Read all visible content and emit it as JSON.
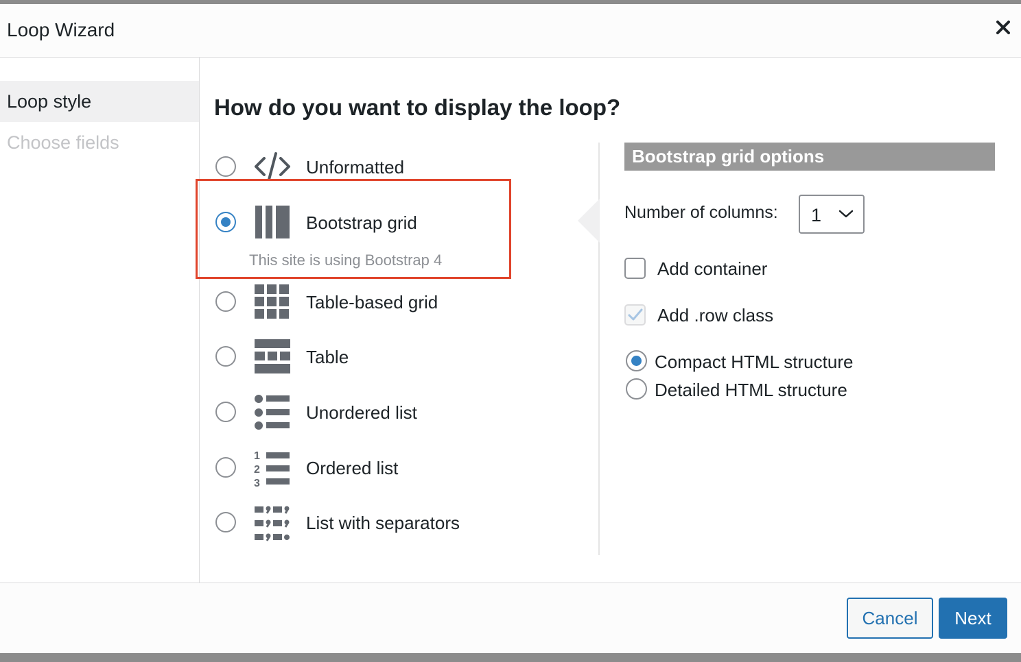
{
  "dialog": {
    "title": "Loop Wizard"
  },
  "sidebar": {
    "items": [
      {
        "label": "Loop style"
      },
      {
        "label": "Choose fields"
      }
    ]
  },
  "main": {
    "question": "How do you want to display the loop?",
    "options": [
      {
        "label": "Unformatted",
        "icon": "code-icon",
        "selected": false
      },
      {
        "label": "Bootstrap grid",
        "icon": "bootstrap-grid-icon",
        "selected": true,
        "note": "This site is using Bootstrap 4"
      },
      {
        "label": "Table-based grid",
        "icon": "table-grid-icon",
        "selected": false
      },
      {
        "label": "Table",
        "icon": "table-icon",
        "selected": false
      },
      {
        "label": "Unordered list",
        "icon": "unordered-list-icon",
        "selected": false
      },
      {
        "label": "Ordered list",
        "icon": "ordered-list-icon",
        "selected": false
      },
      {
        "label": "List with separators",
        "icon": "separator-list-icon",
        "selected": false
      }
    ]
  },
  "grid_options": {
    "header": "Bootstrap grid options",
    "columns_label": "Number of columns:",
    "columns_value": "1",
    "add_container_label": "Add container",
    "add_container_checked": false,
    "add_row_label": "Add .row class",
    "add_row_checked": true,
    "structure_options": [
      {
        "label": "Compact HTML structure",
        "selected": true
      },
      {
        "label": "Detailed HTML structure",
        "selected": false
      }
    ]
  },
  "footer": {
    "cancel_label": "Cancel",
    "next_label": "Next"
  },
  "colors": {
    "accent": "#2271b1",
    "radio_checked": "#3582c4",
    "highlight_border": "#e0442b",
    "options_header_bg": "#999999",
    "icon_gray": "#646970"
  }
}
